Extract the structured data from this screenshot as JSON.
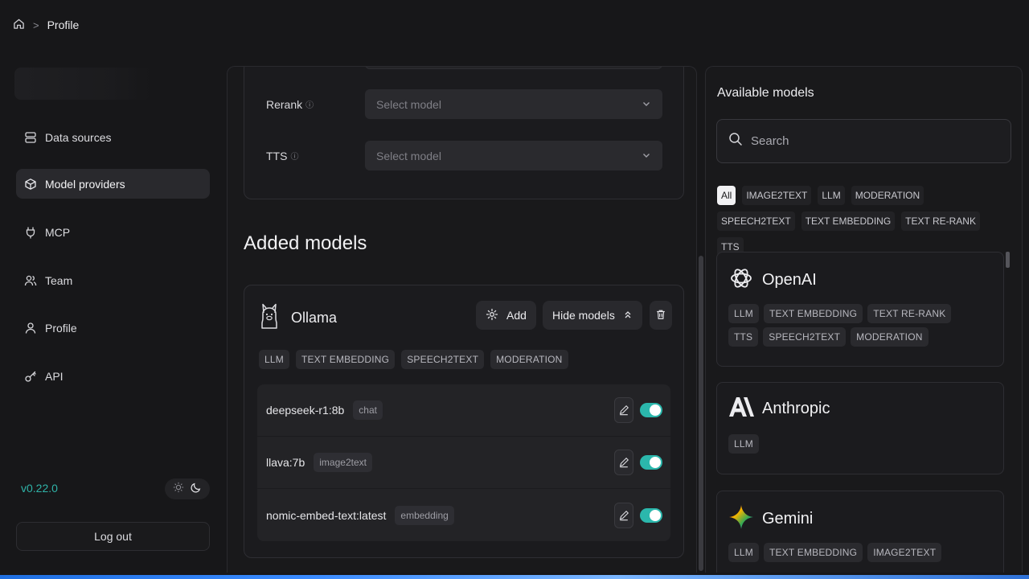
{
  "breadcrumb": {
    "home_icon": "home-icon",
    "separator": ">",
    "current": "Profile"
  },
  "sidebar": {
    "items": [
      {
        "label": "Data sources",
        "icon": "database-icon",
        "active": false
      },
      {
        "label": "Model providers",
        "icon": "cube-icon",
        "active": true
      },
      {
        "label": "MCP",
        "icon": "plug-icon",
        "active": false
      },
      {
        "label": "Team",
        "icon": "users-icon",
        "active": false
      },
      {
        "label": "Profile",
        "icon": "user-icon",
        "active": false
      },
      {
        "label": "API",
        "icon": "key-icon",
        "active": false
      }
    ],
    "version": "v0.22.0",
    "logout": "Log out"
  },
  "defaults": {
    "rows": [
      {
        "label": "Rerank",
        "placeholder": "Select model"
      },
      {
        "label": "TTS",
        "placeholder": "Select model"
      }
    ]
  },
  "added": {
    "title": "Added models",
    "provider": {
      "name": "Ollama",
      "add_label": "Add",
      "hide_label": "Hide models",
      "tags": [
        "LLM",
        "TEXT EMBEDDING",
        "SPEECH2TEXT",
        "MODERATION"
      ],
      "models": [
        {
          "name": "deepseek-r1:8b",
          "type": "chat",
          "enabled": true
        },
        {
          "name": "llava:7b",
          "type": "image2text",
          "enabled": true
        },
        {
          "name": "nomic-embed-text:latest",
          "type": "embedding",
          "enabled": true
        }
      ]
    }
  },
  "available": {
    "title": "Available models",
    "search_placeholder": "Search",
    "filters": [
      "All",
      "IMAGE2TEXT",
      "LLM",
      "MODERATION",
      "SPEECH2TEXT",
      "TEXT EMBEDDING",
      "TEXT RE-RANK",
      "TTS"
    ],
    "active_filter": "All",
    "providers": [
      {
        "name": "OpenAI",
        "tags": [
          "LLM",
          "TEXT EMBEDDING",
          "TEXT RE-RANK",
          "TTS",
          "SPEECH2TEXT",
          "MODERATION"
        ]
      },
      {
        "name": "Anthropic",
        "tags": [
          "LLM"
        ]
      },
      {
        "name": "Gemini",
        "tags": [
          "LLM",
          "TEXT EMBEDDING",
          "IMAGE2TEXT"
        ]
      }
    ]
  },
  "colors": {
    "accent": "#2bb7ac",
    "version": "#2fb3a8",
    "background": "#171719"
  }
}
